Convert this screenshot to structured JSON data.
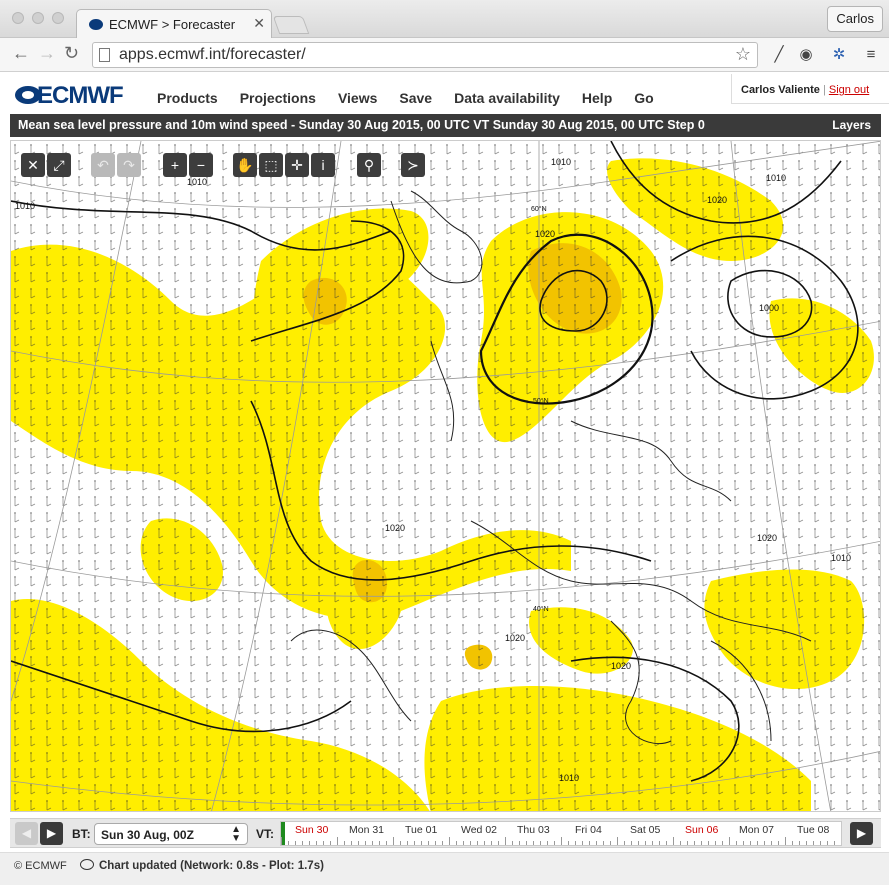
{
  "browser": {
    "tab_title": "ECMWF > Forecaster",
    "url": "apps.ecmwf.int/forecaster/",
    "profile_name": "Carlos"
  },
  "header": {
    "logo_text": "ECMWF",
    "menu": [
      "Products",
      "Projections",
      "Views",
      "Save",
      "Data availability",
      "Help",
      "Go"
    ],
    "user_name": "Carlos Valiente",
    "separator": "|",
    "sign_out": "Sign out"
  },
  "chart": {
    "title": "Mean sea level pressure and 10m wind speed - Sunday 30 Aug 2015, 00 UTC VT Sunday 30 Aug 2015, 00 UTC Step 0",
    "layers_label": "Layers",
    "isobar_labels": [
      "1010",
      "1010",
      "1010",
      "1020",
      "1020",
      "1020",
      "1000",
      "1020",
      "1010",
      "1020",
      "1020",
      "1010",
      "1010"
    ],
    "lat_labels": [
      "60°N",
      "50°N",
      "40°N"
    ],
    "colors": {
      "wind_fill": "#ffee00",
      "wind_fill_strong": "#f2c300",
      "isobar": "#111111",
      "graticule": "#9a9a9a"
    }
  },
  "map_tools": [
    {
      "name": "close-icon",
      "glyph": "✕"
    },
    {
      "name": "fullscreen-icon",
      "glyph": "⤢"
    },
    {
      "name": "undo-icon",
      "glyph": "↶"
    },
    {
      "name": "redo-icon",
      "glyph": "↷"
    },
    {
      "name": "zoom-in-icon",
      "glyph": "+"
    },
    {
      "name": "zoom-out-icon",
      "glyph": "−"
    },
    {
      "name": "pan-hand-icon",
      "glyph": "✋"
    },
    {
      "name": "zoom-box-icon",
      "glyph": "⬚"
    },
    {
      "name": "crosshair-icon",
      "glyph": "✛"
    },
    {
      "name": "info-icon",
      "glyph": "i"
    },
    {
      "name": "location-pin-icon",
      "glyph": "⚲"
    },
    {
      "name": "cross-section-icon",
      "glyph": "≻"
    }
  ],
  "timebar": {
    "bt_label": "BT:",
    "bt_value": "Sun 30 Aug, 00Z",
    "vt_label": "VT:",
    "days": [
      "Sun 30",
      "Mon 31",
      "Tue 01",
      "Wed 02",
      "Thu 03",
      "Fri 04",
      "Sat 05",
      "Sun 06",
      "Mon 07",
      "Tue 08"
    ],
    "sunday_color": "#cc0000"
  },
  "status": {
    "copyright": "© ECMWF",
    "message": "Chart updated (Network: 0.8s - Plot: 1.7s)"
  }
}
